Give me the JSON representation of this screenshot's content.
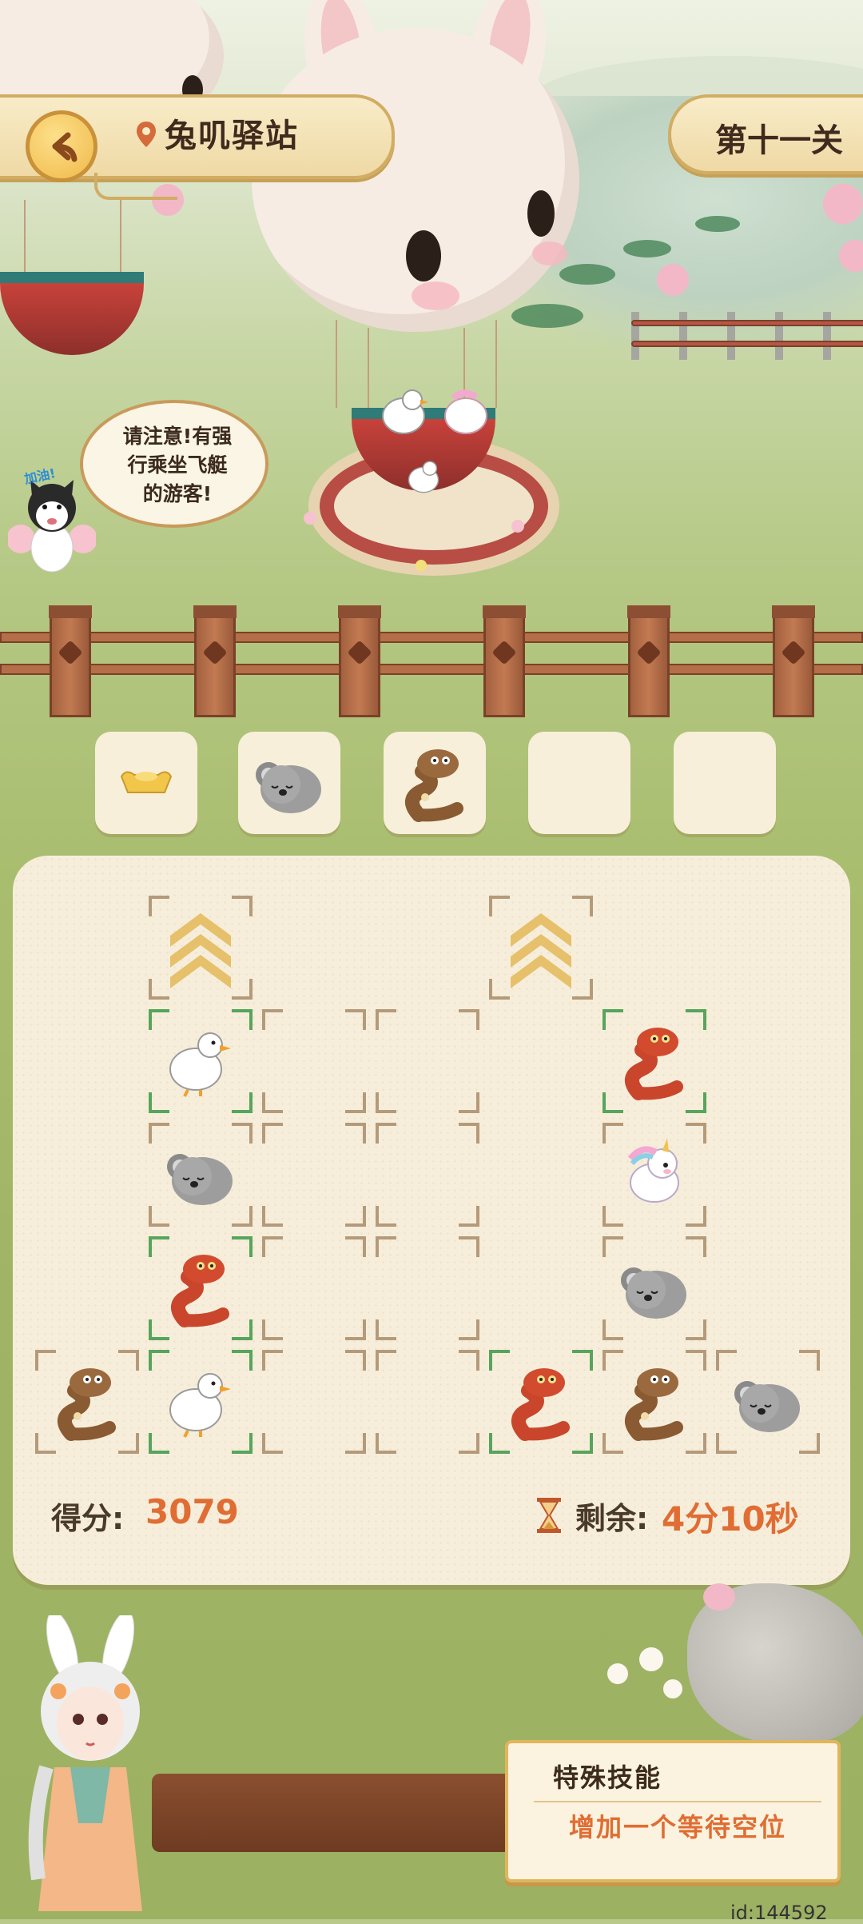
{
  "header": {
    "back_icon": "back-arrow-icon",
    "location_icon": "location-pin-icon",
    "station_name": "兔叽驿站",
    "level_label": "第十一关"
  },
  "speech": {
    "lines": [
      "请注意!有强",
      "行乘坐飞艇",
      "的游客!"
    ],
    "husky_tag": "加油!"
  },
  "waiting_slots": [
    {
      "animal": "gold-ingot"
    },
    {
      "animal": "koala"
    },
    {
      "animal": "brown-snake"
    },
    {
      "animal": ""
    },
    {
      "animal": ""
    }
  ],
  "board": {
    "score_label": "得分:",
    "score_value": "3079",
    "remain_label": "剩余:",
    "remain_value": "4分10秒",
    "cells": [
      {
        "col": 1,
        "row": 0,
        "content": "up-arrows",
        "active": false
      },
      {
        "col": 4,
        "row": 0,
        "content": "up-arrows",
        "active": false
      },
      {
        "col": 1,
        "row": 1,
        "content": "duck",
        "active": true
      },
      {
        "col": 2,
        "row": 1,
        "content": "",
        "active": false
      },
      {
        "col": 3,
        "row": 1,
        "content": "",
        "active": false
      },
      {
        "col": 5,
        "row": 1,
        "content": "red-snake",
        "active": true
      },
      {
        "col": 1,
        "row": 2,
        "content": "koala",
        "active": false
      },
      {
        "col": 2,
        "row": 2,
        "content": "",
        "active": false
      },
      {
        "col": 3,
        "row": 2,
        "content": "",
        "active": false
      },
      {
        "col": 5,
        "row": 2,
        "content": "unicorn",
        "active": false
      },
      {
        "col": 1,
        "row": 3,
        "content": "red-snake",
        "active": true
      },
      {
        "col": 2,
        "row": 3,
        "content": "",
        "active": false
      },
      {
        "col": 3,
        "row": 3,
        "content": "",
        "active": false
      },
      {
        "col": 5,
        "row": 3,
        "content": "koala",
        "active": false
      },
      {
        "col": 0,
        "row": 4,
        "content": "brown-snake",
        "active": false
      },
      {
        "col": 1,
        "row": 4,
        "content": "duck",
        "active": true
      },
      {
        "col": 2,
        "row": 4,
        "content": "",
        "active": false
      },
      {
        "col": 3,
        "row": 4,
        "content": "",
        "active": false
      },
      {
        "col": 4,
        "row": 4,
        "content": "red-snake",
        "active": true
      },
      {
        "col": 5,
        "row": 4,
        "content": "brown-snake",
        "active": false
      },
      {
        "col": 6,
        "row": 4,
        "content": "koala",
        "active": false
      }
    ]
  },
  "skill": {
    "title": "特殊技能",
    "description": "增加一个等待空位"
  },
  "footer": {
    "id_text": "id:144592"
  },
  "colors": {
    "accent_orange": "#e06d33",
    "active_corner": "#57a55c",
    "gold": "#d1ad63"
  }
}
